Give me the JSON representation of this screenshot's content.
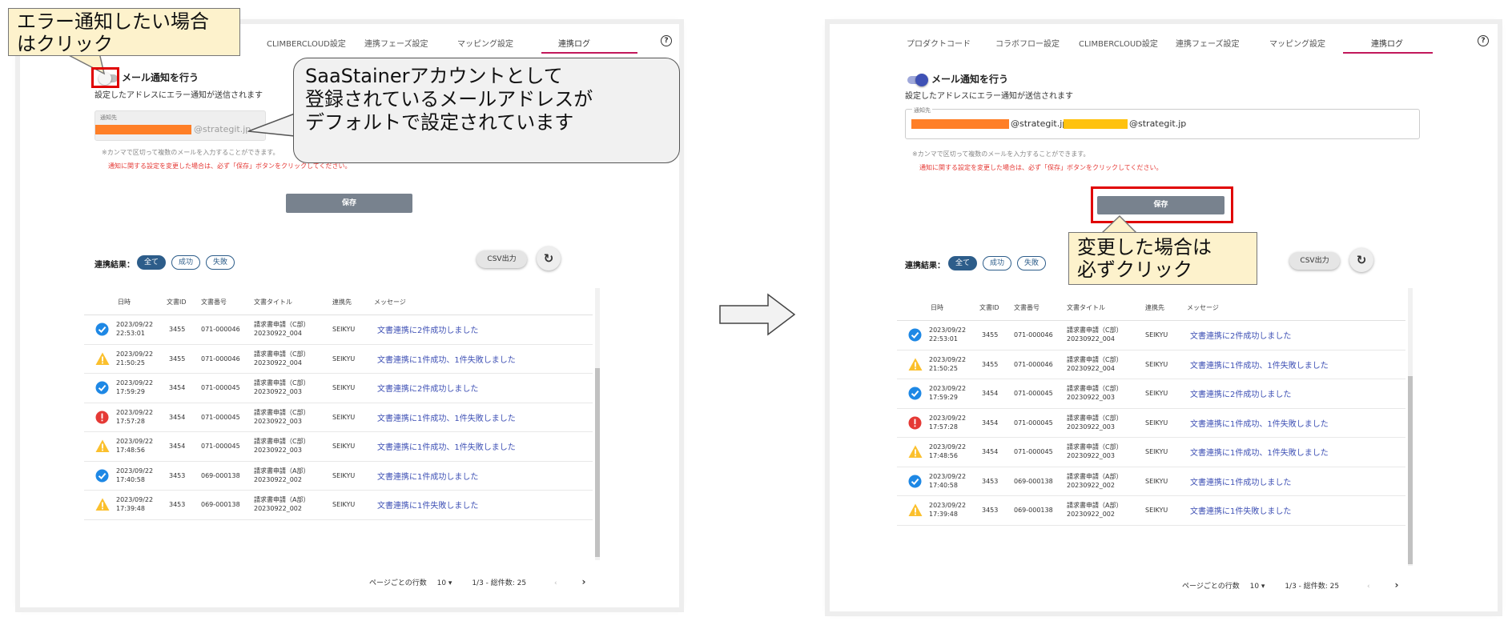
{
  "left": {
    "tabs": [
      "CLIMBERCLOUD設定",
      "連携フェーズ設定",
      "マッピング設定",
      "連携ログ"
    ],
    "active_tab": "連携ログ",
    "toggle_on": false,
    "notify_title": "メール通知を行う",
    "notify_sub": "設定したアドレスにエラー通知が送信されます",
    "field_label": "通知先",
    "email_domain": "@strategit.jp",
    "hint": "※カンマで区切って複数のメールを入力することができます。",
    "warning": "通知に関する設定を変更した場合は、必ず「保存」ボタンをクリックしてください。"
  },
  "right": {
    "tabs": [
      "プロダクトコード",
      "コラボフロー設定",
      "CLIMBERCLOUD設定",
      "連携フェーズ設定",
      "マッピング設定",
      "連携ログ"
    ],
    "active_tab": "連携ログ",
    "toggle_on": true,
    "notify_title": "メール通知を行う",
    "notify_sub": "設定したアドレスにエラー通知が送信されます",
    "field_label": "通知先",
    "email_domain_1": "@strategit.jp,",
    "email_domain_2": "@strategit.jp",
    "hint": "※カンマで区切って複数のメールを入力することができます。",
    "warning": "通知に関する設定を変更した場合は、必ず「保存」ボタンをクリックしてください。"
  },
  "save_label": "保存",
  "filter": {
    "label": "連携結果：",
    "chips": [
      "全て",
      "成功",
      "失敗"
    ],
    "selected": "全て"
  },
  "csv_label": "CSV出力",
  "refresh_icon": "refresh-icon",
  "table": {
    "headers": [
      "日時",
      "文書ID",
      "文書番号",
      "文書タイトル",
      "連携先",
      "メッセージ"
    ],
    "rows": [
      {
        "status": "success",
        "date": "2023/09/22",
        "time": "22:53:01",
        "id": "3455",
        "number": "071-000046",
        "title1": "請求書申請（C部）",
        "title2": "20230922_004",
        "dest": "SEIKYU",
        "message": "文書連携に2件成功しました"
      },
      {
        "status": "warning",
        "date": "2023/09/22",
        "time": "21:50:25",
        "id": "3455",
        "number": "071-000046",
        "title1": "請求書申請（C部）",
        "title2": "20230922_004",
        "dest": "SEIKYU",
        "message": "文書連携に1件成功、1件失敗しました"
      },
      {
        "status": "success",
        "date": "2023/09/22",
        "time": "17:59:29",
        "id": "3454",
        "number": "071-000045",
        "title1": "請求書申請（C部）",
        "title2": "20230922_003",
        "dest": "SEIKYU",
        "message": "文書連携に2件成功しました"
      },
      {
        "status": "error",
        "date": "2023/09/22",
        "time": "17:57:28",
        "id": "3454",
        "number": "071-000045",
        "title1": "請求書申請（C部）",
        "title2": "20230922_003",
        "dest": "SEIKYU",
        "message": "文書連携に1件成功、1件失敗しました"
      },
      {
        "status": "warning",
        "date": "2023/09/22",
        "time": "17:48:56",
        "id": "3454",
        "number": "071-000045",
        "title1": "請求書申請（C部）",
        "title2": "20230922_003",
        "dest": "SEIKYU",
        "message": "文書連携に1件成功、1件失敗しました"
      },
      {
        "status": "success",
        "date": "2023/09/22",
        "time": "17:40:58",
        "id": "3453",
        "number": "069-000138",
        "title1": "請求書申請（A部）",
        "title2": "20230922_002",
        "dest": "SEIKYU",
        "message": "文書連携に1件成功しました"
      },
      {
        "status": "warning",
        "date": "2023/09/22",
        "time": "17:39:48",
        "id": "3453",
        "number": "069-000138",
        "title1": "請求書申請（A部）",
        "title2": "20230922_002",
        "dest": "SEIKYU",
        "message": "文書連携に1件失敗しました"
      }
    ]
  },
  "pagination": {
    "rows_per_page_label": "ページごとの行数",
    "rows_per_page": "10",
    "range": "1/3 - 総件数: 25"
  },
  "annotations": {
    "error_note_line1": "エラー通知したい場合",
    "error_note_line2": "はクリック",
    "saastainer_line1": "SaaStainerアカウントとして",
    "saastainer_line2": "登録されているメールアドレスが",
    "saastainer_line3": "デフォルトで設定されています",
    "save_note_line1": "変更した場合は",
    "save_note_line2": "必ずクリック"
  },
  "colors": {
    "accent": "#2d5d8a",
    "tab_indicator": "#c2185b",
    "toggle_on": "#3f51b5",
    "highlight_red": "#e00000",
    "redact_orange": "#ff7f27",
    "redact_yellow": "#ffc20e",
    "success": "#1e88e5",
    "warning": "#fbc02d",
    "error": "#e53935",
    "link": "#3f51b5"
  }
}
